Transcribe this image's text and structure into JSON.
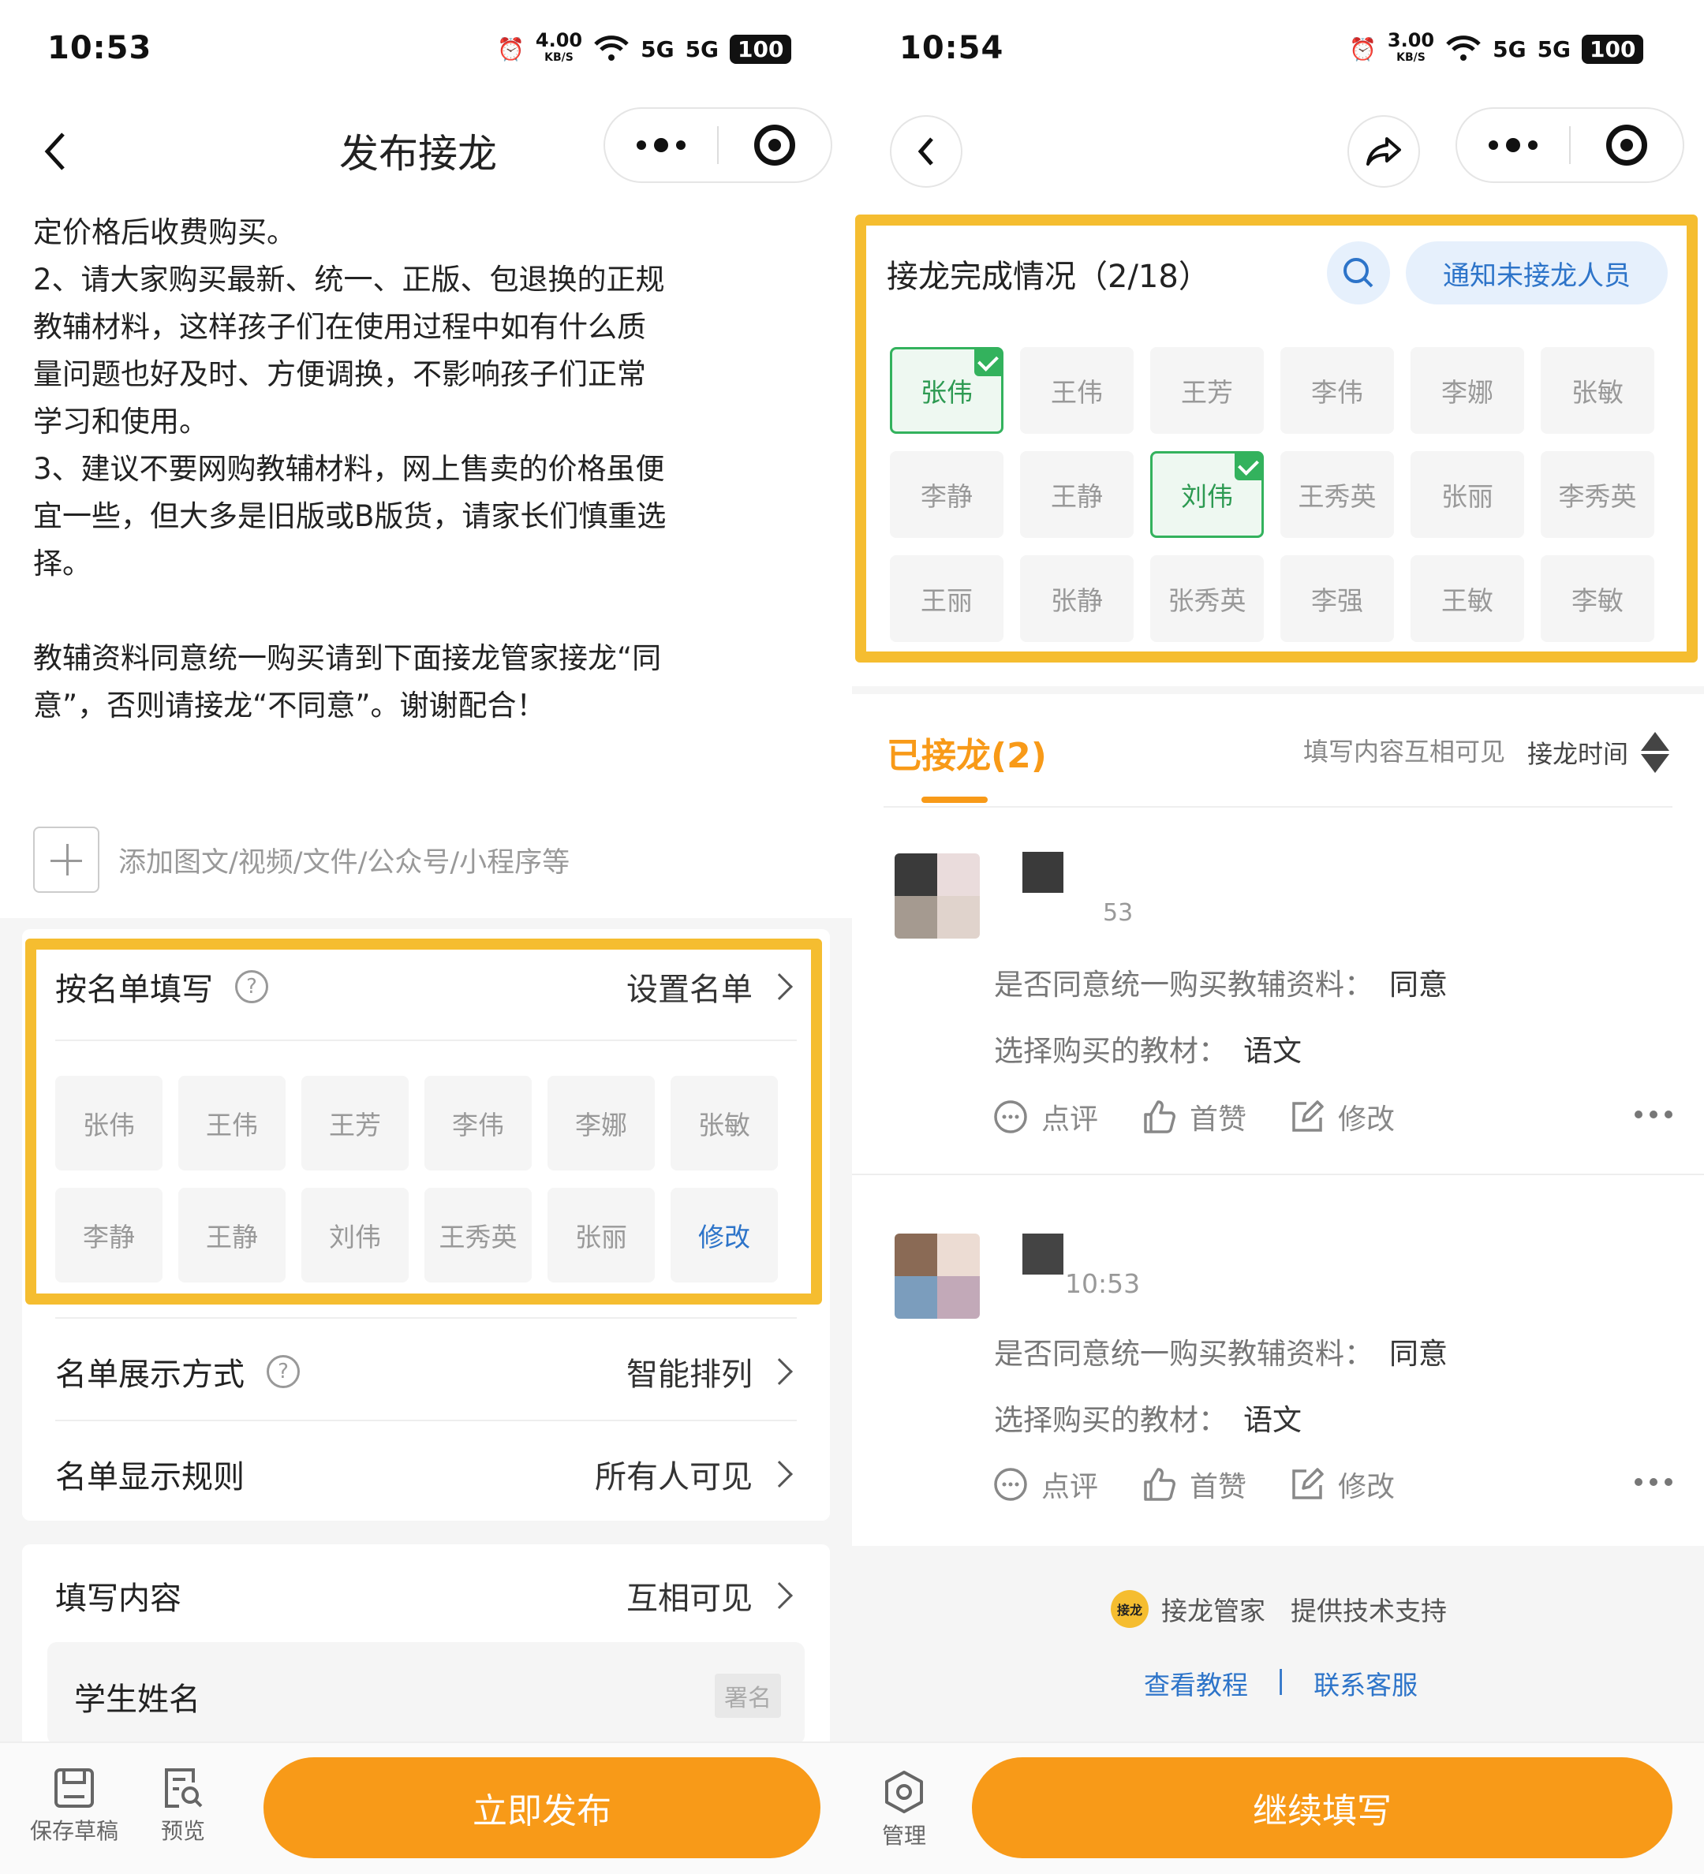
{
  "left": {
    "status": {
      "time": "10:53",
      "netspeed": "4.00",
      "netspeed_unit": "KB/S",
      "net1": "5G",
      "net2": "5G",
      "battery": "100"
    },
    "nav": {
      "title": "发布接龙"
    },
    "intro": [
      "定价格后收费购买。",
      "2、请大家购买最新、统一、正版、包退换的正规",
      "教辅材料，这样孩子们在使用过程中如有什么质",
      "量问题也好及时、方便调换，不影响孩子们正常",
      "学习和使用。",
      "3、建议不要网购教辅材料，网上售卖的价格虽便",
      "宜一些，但大多是旧版或B版货，请家长们慎重选",
      "择。",
      "",
      "教辅资料同意统一购买请到下面接龙管家接龙“同",
      "意”，否则请接龙“不同意”。谢谢配合！"
    ],
    "add_media": "添加图文/视频/文件/公众号/小程序等",
    "roster": {
      "label": "按名单填写",
      "action": "设置名单",
      "names": [
        "张伟",
        "王伟",
        "王芳",
        "李伟",
        "李娜",
        "张敏",
        "李静",
        "王静",
        "刘伟",
        "王秀英",
        "张丽"
      ],
      "edit_label": "修改"
    },
    "display_mode": {
      "label": "名单展示方式",
      "value": "智能排列"
    },
    "display_rule": {
      "label": "名单显示规则",
      "value": "所有人可见"
    },
    "fill_content": {
      "label": "填写内容",
      "value": "互相可见"
    },
    "field": {
      "name": "学生姓名",
      "tag": "署名"
    },
    "toolbar": {
      "save": "保存草稿",
      "preview": "预览",
      "publish": "立即发布"
    }
  },
  "right": {
    "status": {
      "time": "10:54",
      "netspeed": "3.00",
      "netspeed_unit": "KB/S",
      "net1": "5G",
      "net2": "5G",
      "battery": "100"
    },
    "completion": {
      "title": "接龙完成情况（2/18）",
      "notify": "通知未接龙人员",
      "names": [
        {
          "n": "张伟",
          "done": true
        },
        {
          "n": "王伟",
          "done": false
        },
        {
          "n": "王芳",
          "done": false
        },
        {
          "n": "李伟",
          "done": false
        },
        {
          "n": "李娜",
          "done": false
        },
        {
          "n": "张敏",
          "done": false
        },
        {
          "n": "李静",
          "done": false
        },
        {
          "n": "王静",
          "done": false
        },
        {
          "n": "刘伟",
          "done": true
        },
        {
          "n": "王秀英",
          "done": false
        },
        {
          "n": "张丽",
          "done": false
        },
        {
          "n": "李秀英",
          "done": false
        },
        {
          "n": "王丽",
          "done": false
        },
        {
          "n": "张静",
          "done": false
        },
        {
          "n": "张秀英",
          "done": false
        },
        {
          "n": "李强",
          "done": false
        },
        {
          "n": "王敏",
          "done": false
        },
        {
          "n": "李敏",
          "done": false
        }
      ]
    },
    "joined": {
      "title": "已接龙(2)",
      "visibility": "填写内容互相可见",
      "sort": "接龙时间"
    },
    "entries": [
      {
        "time": "53",
        "q1": "是否同意统一购买教辅资料：",
        "a1": "同意",
        "q2": "选择购买的教材：",
        "a2": "语文",
        "avatar_colors": [
          "#3a3a3a",
          "#eadcdc",
          "#a59a90",
          "#e0d3cc"
        ]
      },
      {
        "time": "10:53",
        "q1": "是否同意统一购买教辅资料：",
        "a1": "同意",
        "q2": "选择购买的教材：",
        "a2": "语文",
        "avatar_colors": [
          "#8a6a55",
          "#ecdcd3",
          "#7b9dbd",
          "#c2a9b8"
        ]
      }
    ],
    "actions": {
      "comment": "点评",
      "like": "首赞",
      "edit": "修改"
    },
    "footer": {
      "logo": "接龙",
      "brand": "接龙管家",
      "support": "提供技术支持",
      "tutorial": "查看教程",
      "separator": "|",
      "service": "联系客服"
    },
    "toolbar": {
      "manage": "管理",
      "continue": "继续填写"
    }
  },
  "colors": {
    "accent": "#f89a18",
    "highlight": "#f5bd30",
    "done_green": "#33b25d",
    "link_blue": "#2d74c9"
  }
}
